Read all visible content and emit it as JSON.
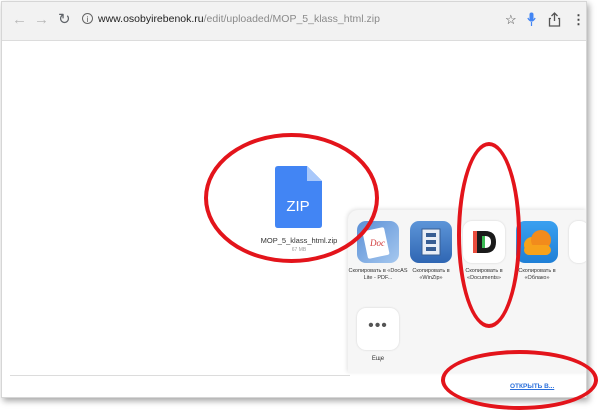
{
  "browser": {
    "url_domain": "www.osobyirebenok.ru",
    "url_path": "/edit/uploaded/MOP_5_klass_html.zip"
  },
  "file": {
    "icon_label": "ZIP",
    "name": "MOP_5_klass_html.zip",
    "size": "67 MB"
  },
  "share_sheet": {
    "apps": [
      {
        "label": "Скопировать в «DocAS Lite - PDF...",
        "icon": "docas-icon"
      },
      {
        "label": "Скопировать в «WinZip»",
        "icon": "winzip-icon"
      },
      {
        "label": "Скопировать в «Documents»",
        "icon": "documents-icon"
      },
      {
        "label": "Скопировать в «Облако»",
        "icon": "cloud-icon"
      }
    ],
    "more_label": "Еще",
    "open_in_label": "ОТКРЫТЬ В..."
  },
  "colors": {
    "zip_blue": "#4285f4",
    "annotation_red": "#e3141b",
    "link_blue": "#2a6fdb"
  }
}
